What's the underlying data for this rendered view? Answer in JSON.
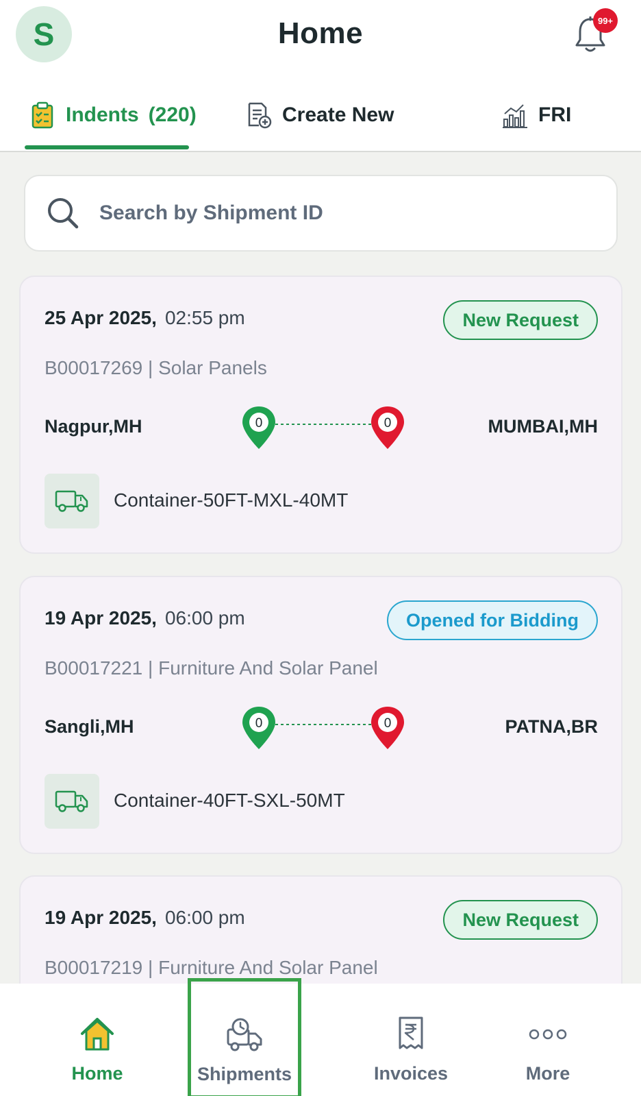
{
  "header": {
    "avatar_initial": "S",
    "title": "Home",
    "notification_badge": "99+"
  },
  "tabs": [
    {
      "label": "Indents",
      "count": "(220)",
      "icon": "clipboard-icon",
      "active": true
    },
    {
      "label": "Create New",
      "icon": "document-add-icon",
      "active": false
    },
    {
      "label": "FRI",
      "icon": "chart-icon",
      "active": false
    }
  ],
  "search": {
    "placeholder": "Search by Shipment ID"
  },
  "cards": [
    {
      "date": "25 Apr 2025,",
      "time": "02:55 pm",
      "status": "New Request",
      "subtitle": "B00017269 | Solar Panels",
      "from": "Nagpur,MH",
      "to": "MUMBAI,MH",
      "from_count": "0",
      "to_count": "0",
      "vehicle": "Container-50FT-MXL-40MT"
    },
    {
      "date": "19 Apr 2025,",
      "time": "06:00 pm",
      "status": "Opened for Bidding",
      "subtitle": "B00017221 | Furniture And Solar Panel",
      "from": "Sangli,MH",
      "to": "PATNA,BR",
      "from_count": "0",
      "to_count": "0",
      "vehicle": "Container-40FT-SXL-50MT"
    },
    {
      "date": "19 Apr 2025,",
      "time": "06:00 pm",
      "status": "New Request",
      "subtitle": "B00017219 | Furniture And Solar Panel"
    }
  ],
  "bottom_nav": [
    {
      "label": "Home",
      "icon": "home-icon",
      "active": true
    },
    {
      "label": "Shipments",
      "icon": "shipment-truck-icon",
      "active": false
    },
    {
      "label": "Invoices",
      "icon": "rupee-invoice-icon",
      "active": false
    },
    {
      "label": "More",
      "icon": "more-dots-icon",
      "active": false
    }
  ],
  "colors": {
    "brand_green": "#23934f",
    "bid_blue": "#1b9acc",
    "pin_red": "#e0192f",
    "card_bg": "#f6f2f8"
  }
}
